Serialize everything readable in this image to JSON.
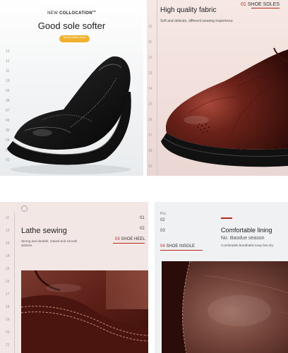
{
  "panels": {
    "sole": {
      "pre": "NEW",
      "collocation": "COLLOCATION",
      "tm": "TM",
      "title": "Good sole softer",
      "pill": "Trendy leather shoes",
      "marks": [
        "13",
        "12",
        "11",
        "10",
        "09",
        "08",
        "07",
        "06",
        "05",
        "04",
        "03",
        "02"
      ]
    },
    "fabric": {
      "title": "High quality fabric",
      "tag_num": "01",
      "tag_text": "SHOE SOLES",
      "subtitle": "Soft and delicate, different wearing experience",
      "marks": [
        "10",
        "11",
        "12",
        "13",
        "14",
        "15",
        "16",
        "17",
        "18",
        "19"
      ]
    },
    "lathe": {
      "title": "Lathe sewing",
      "description": "Strong and durable, natural and smooth stitches.",
      "tag_num": "03",
      "tag_text": "SHOE HEEL",
      "num_top": "01",
      "num_bottom": "02",
      "marks": [
        "11",
        "12",
        "13",
        "14",
        "15",
        "16",
        "17",
        "18",
        "19",
        "20",
        "21"
      ]
    },
    "insole": {
      "title": "Comfortable lining",
      "subtitle": "No. Baodue season",
      "description": "Comfortable breathable keep feet dry",
      "tag_num": "04",
      "tag_text": "SHOE INSOLE",
      "pro": "Pro",
      "num_top": "02",
      "num_bottom": "03",
      "marks": [
        "01",
        "02",
        "03",
        "04",
        "05",
        "06",
        "07",
        "08",
        "09",
        "10",
        "11"
      ]
    }
  },
  "colors": {
    "accent": "#b52a1d",
    "pill": "#f0b030",
    "leather_dark": "#1c1c1c",
    "leather_brown": "#5a1e16"
  }
}
